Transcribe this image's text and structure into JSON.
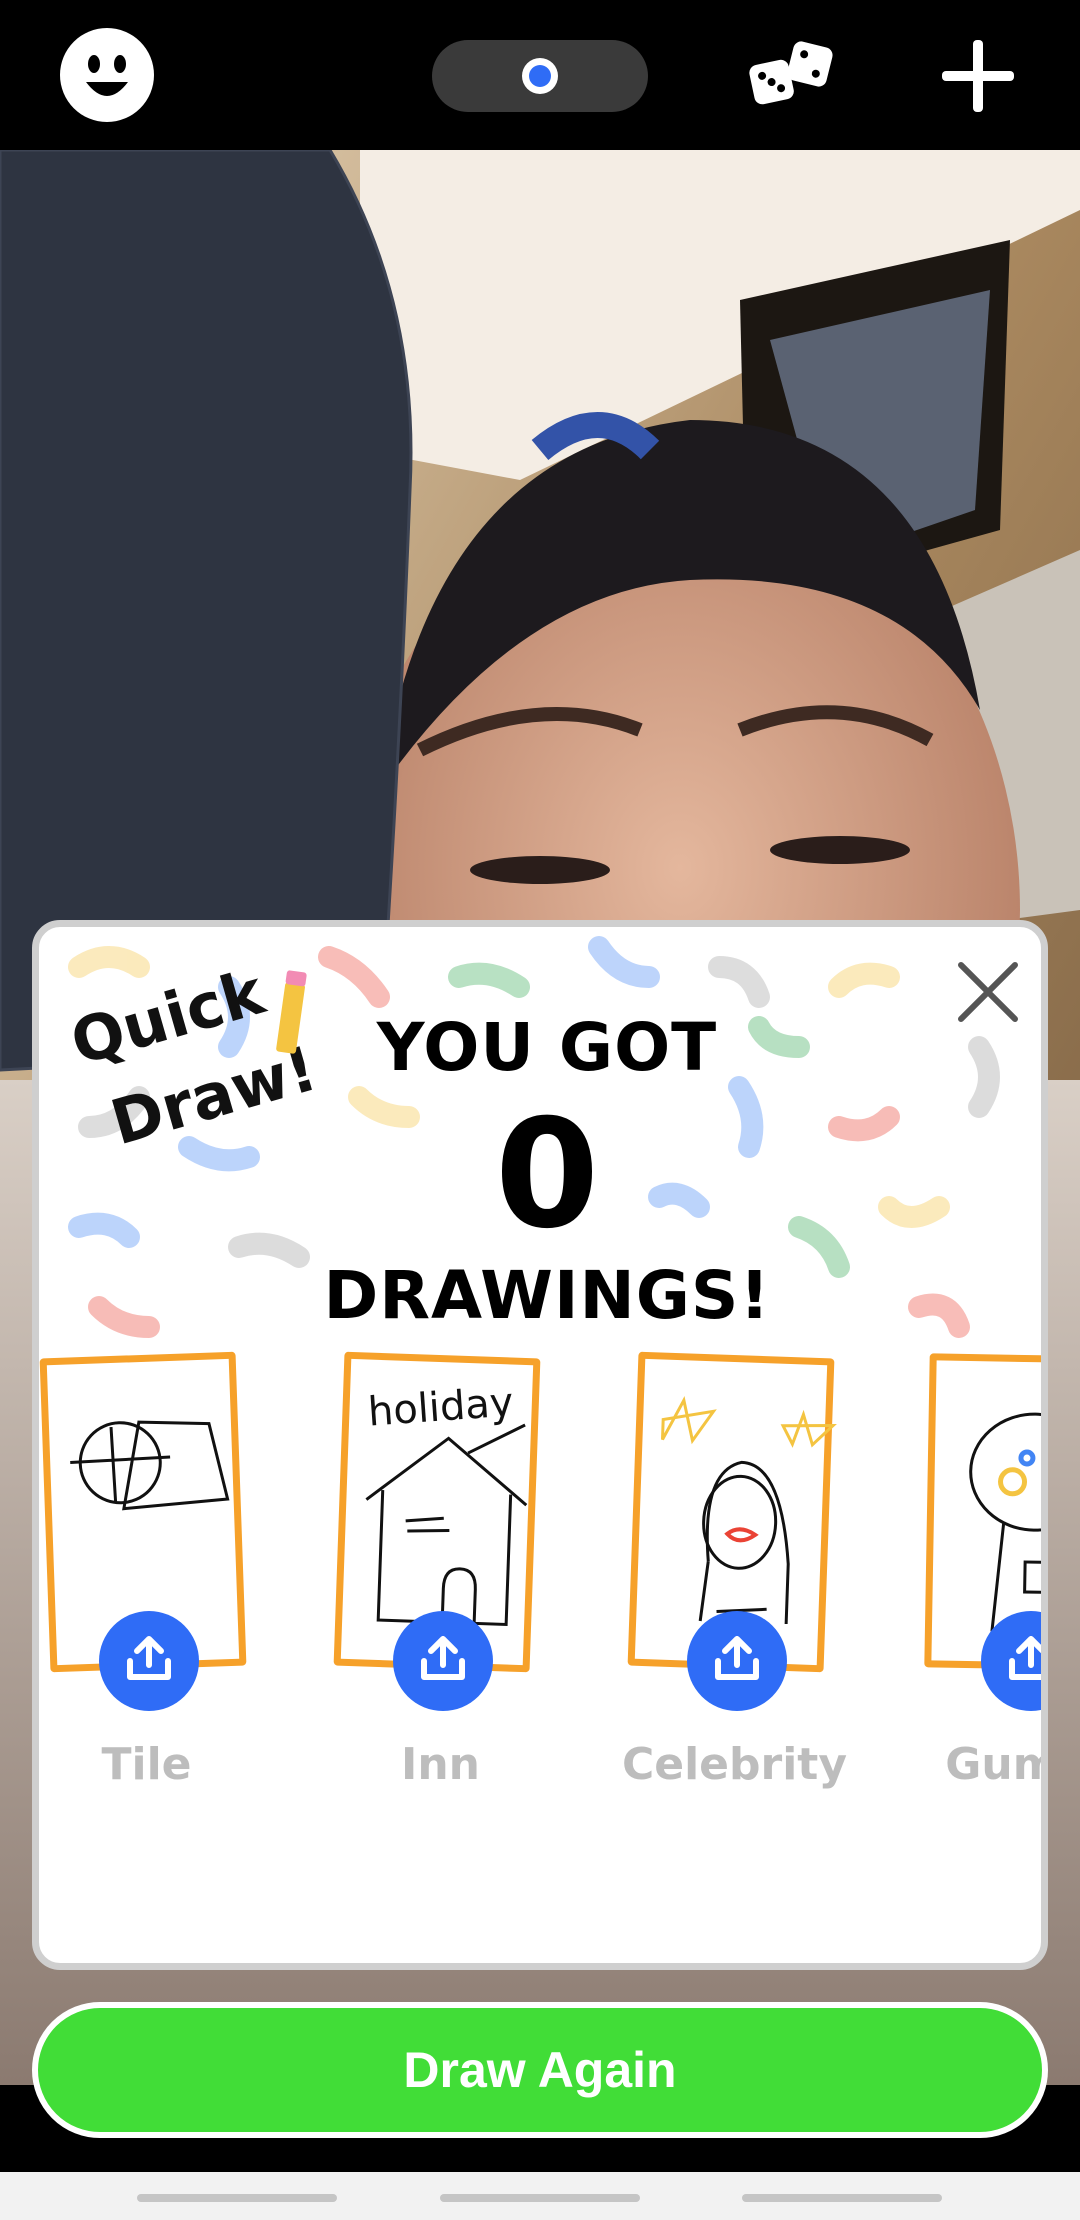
{
  "topbar": {
    "icons": [
      "smiley-face-icon",
      "camera-toggle-icon",
      "dice-icon",
      "plus-icon"
    ],
    "colors": {
      "background": "#000000",
      "toggle_dot": "#2f6cf6"
    }
  },
  "camera": {
    "icon": "camera-preview"
  },
  "card": {
    "logo_text": "Quick Draw!",
    "headline_top": "YOU GOT",
    "count": "0",
    "headline_bottom": "DRAWINGS!",
    "close_icon": "close-icon",
    "items": [
      {
        "label": "Tile",
        "share_icon": "share-icon"
      },
      {
        "label": "Inn",
        "share_icon": "share-icon",
        "doodle_text": "holiday"
      },
      {
        "label": "Celebrity",
        "share_icon": "share-icon"
      },
      {
        "label": "Gumdr",
        "share_icon": "share-icon"
      }
    ],
    "colors": {
      "paper_border": "#f6a12a",
      "share_button": "#2f6cf6",
      "label": "#bdbdbd"
    }
  },
  "actions": {
    "draw_again_label": "Draw Again",
    "draw_again_color": "#41dd37"
  }
}
